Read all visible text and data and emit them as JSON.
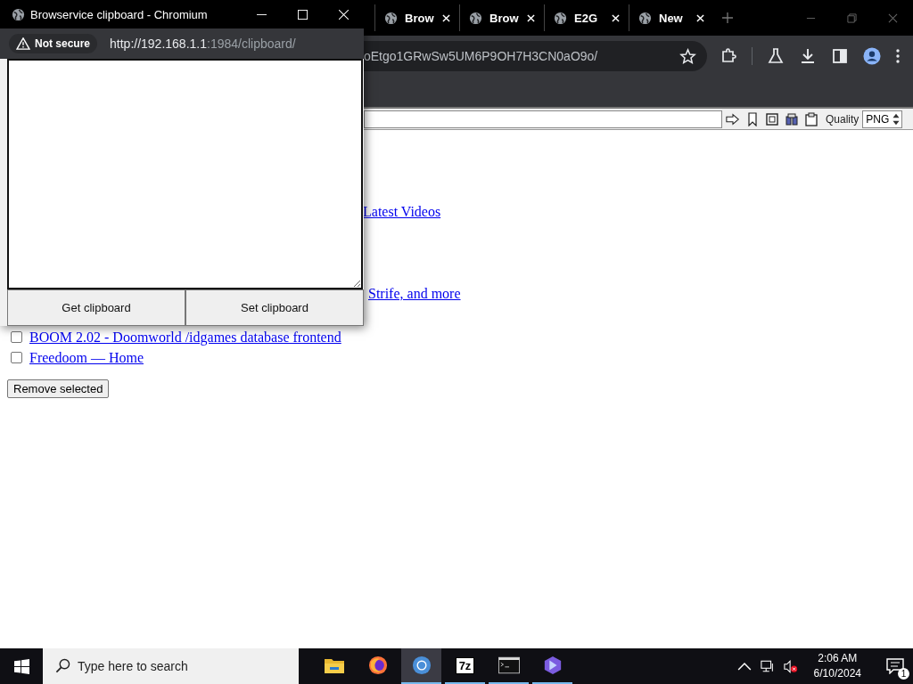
{
  "browser": {
    "tabs": [
      {
        "label": "Brow"
      },
      {
        "label": "Brow"
      },
      {
        "label": "E2G"
      },
      {
        "label": "New"
      }
    ],
    "address": "oEtgo1GRwSw5UM6P9OH7H3CN0aO9o/",
    "toolbar": {
      "quality_label": "Quality",
      "format": "PNG"
    }
  },
  "page": {
    "partial_links": [
      "Latest Videos",
      "Strife, and more"
    ],
    "items": [
      {
        "label": "BOOM 2.02 - Doomworld /idgames database frontend",
        "checked": false
      },
      {
        "label": "Freedoom — Home",
        "checked": false
      }
    ],
    "remove_button": "Remove selected"
  },
  "popup": {
    "title": "Browservice clipboard - Chromium",
    "security": "Not secure",
    "url_host": "http://192.168.1.1",
    "url_rest": ":1984/clipboard/",
    "buttons": [
      "Get clipboard",
      "Set clipboard"
    ]
  },
  "taskbar": {
    "search_placeholder": "Type here to search",
    "apps": [
      {
        "kind": "folder",
        "selected": false,
        "running": false
      },
      {
        "kind": "fox",
        "selected": false,
        "running": false
      },
      {
        "kind": "ring",
        "selected": true,
        "running": true
      },
      {
        "kind": "archive",
        "label": "7z",
        "selected": false,
        "running": true
      },
      {
        "kind": "terminal",
        "selected": false,
        "running": true
      },
      {
        "kind": "hex",
        "selected": false,
        "running": true
      }
    ],
    "time": "2:06 AM",
    "date": "6/10/2024",
    "notifications": "1"
  }
}
